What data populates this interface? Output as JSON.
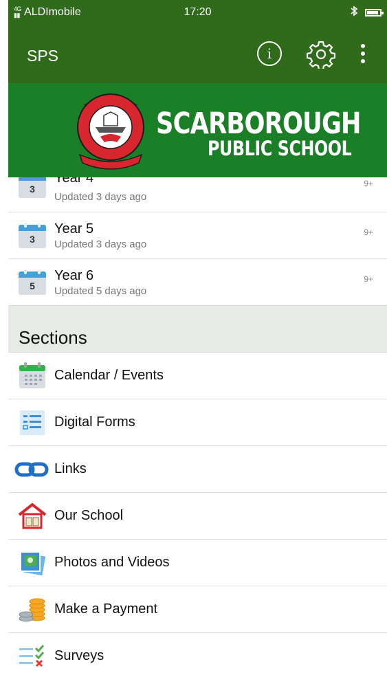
{
  "status_bar": {
    "signal": "4G",
    "carrier": "ALDImobile",
    "time": "17:20",
    "battery_level": 0.9
  },
  "app_bar": {
    "title": "SPS",
    "icons": [
      "info-icon",
      "gear-icon",
      "more-vert-icon"
    ]
  },
  "banner": {
    "line1": "SCARBOROUGH",
    "line2": "PUBLIC SCHOOL",
    "crest_text_top": "SCARBOROUGH PUBLIC SCHOOL",
    "crest_motto": "TRUTH HONOUR",
    "colors": {
      "app_bar": "#2f6b1b",
      "banner": "#1b7f27",
      "crest": "#d8262e"
    }
  },
  "year_items": [
    {
      "label": "Year 4",
      "date_num": "3",
      "updated": "Updated 3 days ago",
      "badge": "9+"
    },
    {
      "label": "Year 5",
      "date_num": "3",
      "updated": "Updated 3 days ago",
      "badge": "9+"
    },
    {
      "label": "Year 6",
      "date_num": "5",
      "updated": "Updated 5 days ago",
      "badge": "9+"
    }
  ],
  "sections": {
    "heading": "Sections",
    "items": [
      {
        "label": "Calendar / Events",
        "icon": "calendar-icon"
      },
      {
        "label": "Digital Forms",
        "icon": "form-icon"
      },
      {
        "label": "Links",
        "icon": "link-icon"
      },
      {
        "label": "Our School",
        "icon": "school-icon"
      },
      {
        "label": "Photos and Videos",
        "icon": "photos-icon"
      },
      {
        "label": "Make a Payment",
        "icon": "coins-icon"
      },
      {
        "label": "Surveys",
        "icon": "survey-icon"
      }
    ]
  }
}
